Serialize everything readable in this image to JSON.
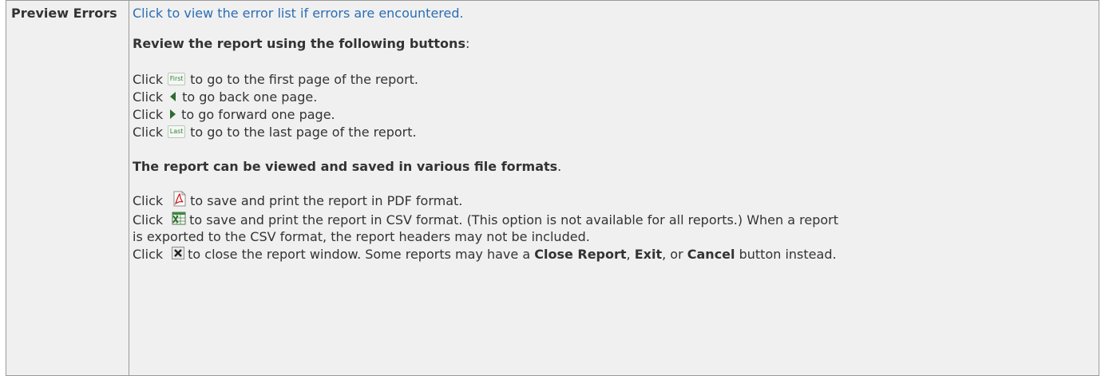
{
  "row": {
    "label": "Preview Errors",
    "link_text": "Click to view the error list if errors are encountered."
  },
  "review": {
    "heading": "Review the report using the following buttons",
    "heading_suffix": ":",
    "lines": [
      {
        "prefix": "Click",
        "icon": "first-button-icon",
        "icon_text": "First",
        "text": "to go to the first page of the report."
      },
      {
        "prefix": "Click",
        "icon": "previous-page-icon",
        "text": "to go back one page."
      },
      {
        "prefix": "Click",
        "icon": "next-page-icon",
        "text": "to go forward one page."
      },
      {
        "prefix": "Click",
        "icon": "last-button-icon",
        "icon_text": "Last",
        "text": "to go to the last page of the report."
      }
    ]
  },
  "formats": {
    "heading": "The report can be viewed and saved in various file formats",
    "heading_suffix": ".",
    "pdf_prefix": "Click",
    "pdf_text": "to save and print the report in PDF format.",
    "csv_prefix": "Click",
    "csv_text": "to save and print the report in CSV format. (This option is not available for all reports.) When a report",
    "csv_text_cont": "is exported to the CSV format, the report headers may not be included.",
    "close_prefix": "Click",
    "close_text_1": "to close the report window. Some reports may have a",
    "close_report": "Close Report",
    "comma_1": ",",
    "exit": "Exit",
    "comma_or": ", or",
    "cancel": "Cancel",
    "close_text_2": "button instead."
  },
  "colors": {
    "link": "#2b6db5",
    "cell_bg": "#f0f0f0",
    "border": "#9a9a9a",
    "icon_green": "#2f6b2f",
    "pdf_red": "#d42020"
  }
}
